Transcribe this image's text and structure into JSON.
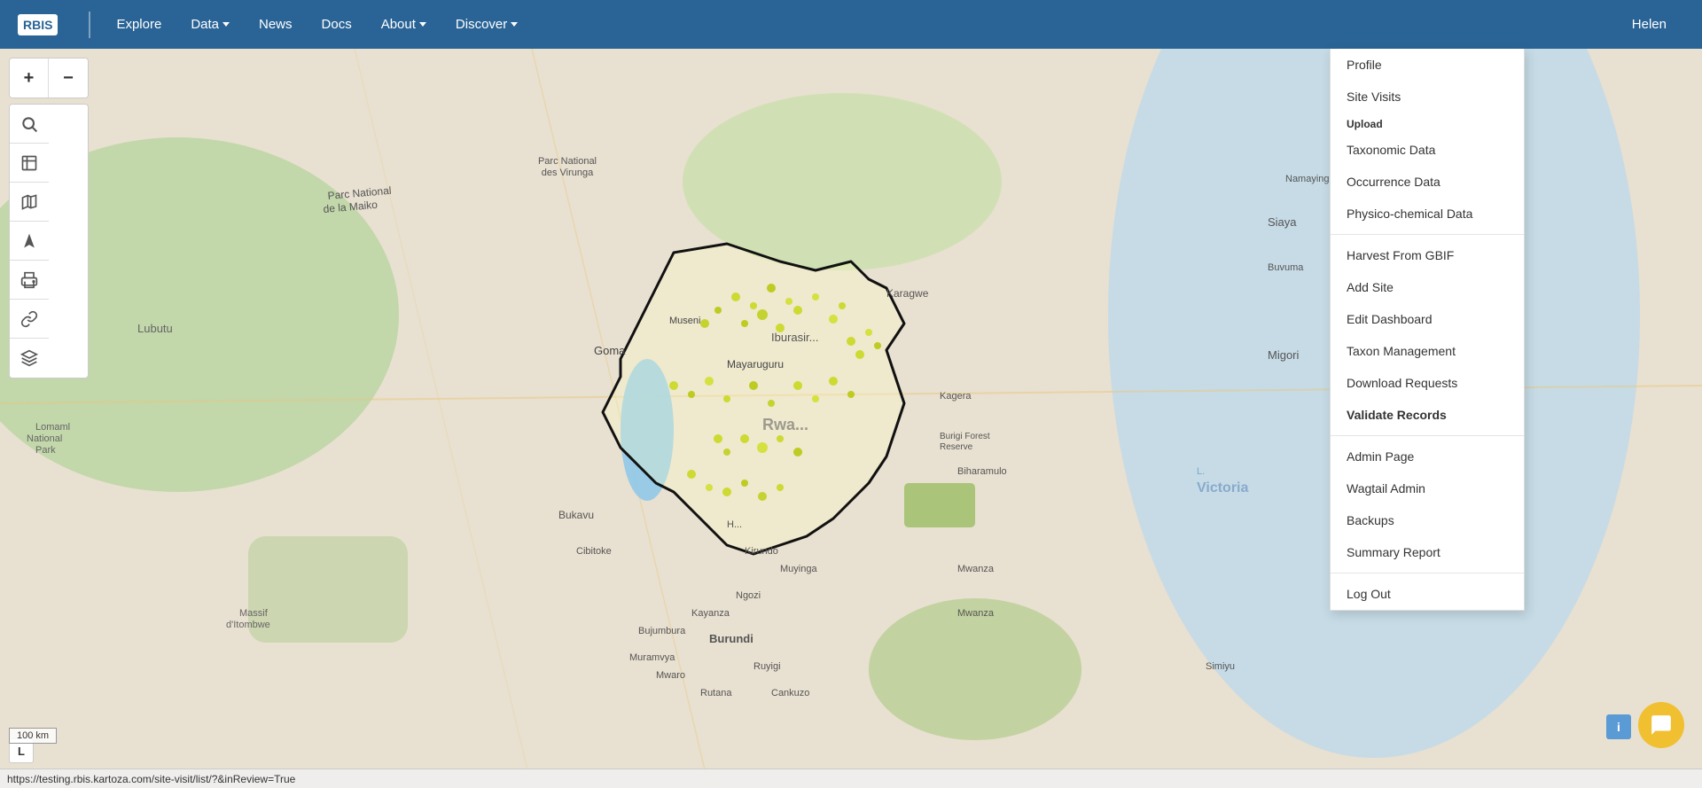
{
  "navbar": {
    "brand": "RBIS",
    "items": [
      {
        "label": "Explore",
        "has_dropdown": false
      },
      {
        "label": "Data",
        "has_dropdown": true
      },
      {
        "label": "News",
        "has_dropdown": false
      },
      {
        "label": "Docs",
        "has_dropdown": false
      },
      {
        "label": "About",
        "has_dropdown": true
      },
      {
        "label": "Discover",
        "has_dropdown": true
      }
    ],
    "user": "Helen"
  },
  "toolbar": {
    "zoom_in": "+",
    "zoom_out": "−",
    "search_icon": "🔍",
    "frame_icon": "⊞",
    "map_icon": "🗺",
    "navigate_icon": "➤",
    "print_icon": "🖶",
    "link_icon": "🔗",
    "layers_icon": "◈"
  },
  "dropdown_menu": {
    "items": [
      {
        "label": "Profile",
        "type": "item",
        "bold": false
      },
      {
        "label": "Site Visits",
        "type": "item",
        "bold": false
      },
      {
        "label": "Upload",
        "type": "section_label"
      },
      {
        "label": "Taxonomic Data",
        "type": "item",
        "bold": false
      },
      {
        "label": "Occurrence Data",
        "type": "item",
        "bold": false
      },
      {
        "label": "Physico-chemical Data",
        "type": "item",
        "bold": false
      },
      {
        "label": "",
        "type": "divider"
      },
      {
        "label": "Harvest From GBIF",
        "type": "item",
        "bold": false
      },
      {
        "label": "Add Site",
        "type": "item",
        "bold": false
      },
      {
        "label": "Edit Dashboard",
        "type": "item",
        "bold": false
      },
      {
        "label": "Taxon Management",
        "type": "item",
        "bold": false
      },
      {
        "label": "Download Requests",
        "type": "item",
        "bold": false
      },
      {
        "label": "Validate Records",
        "type": "item",
        "bold": true
      },
      {
        "label": "",
        "type": "divider"
      },
      {
        "label": "Admin Page",
        "type": "item",
        "bold": false
      },
      {
        "label": "Wagtail Admin",
        "type": "item",
        "bold": false
      },
      {
        "label": "Backups",
        "type": "item",
        "bold": false
      },
      {
        "label": "Summary Report",
        "type": "item",
        "bold": false
      },
      {
        "label": "",
        "type": "divider"
      },
      {
        "label": "Log Out",
        "type": "item",
        "bold": false
      }
    ]
  },
  "scale_bar": {
    "label": "100 km"
  },
  "url_bar": {
    "url": "https://testing.rbis.kartoza.com/site-visit/list/?&inReview=True"
  },
  "l_badge": "L"
}
